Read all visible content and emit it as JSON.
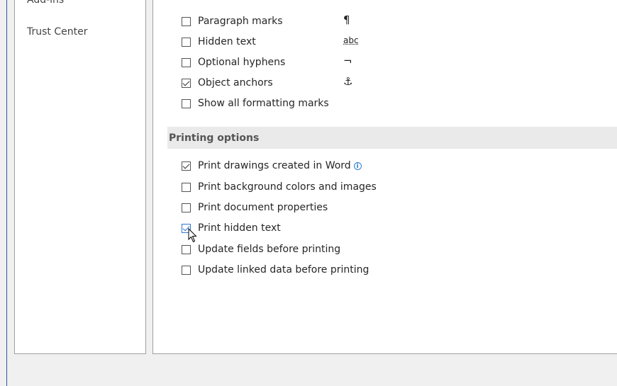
{
  "nav": {
    "partial_item": "Add-ins",
    "trust_center": "Trust Center"
  },
  "display_marks": [
    {
      "label": "Paragraph marks",
      "checked": false,
      "glyph": "¶"
    },
    {
      "label": "Hidden text",
      "checked": false,
      "glyph": "abc"
    },
    {
      "label": "Optional hyphens",
      "checked": false,
      "glyph": "¬"
    },
    {
      "label": "Object anchors",
      "checked": true,
      "glyph": "⚓"
    },
    {
      "label": "Show all formatting marks",
      "checked": false
    }
  ],
  "printing": {
    "header": "Printing options",
    "options": [
      {
        "label": "Print drawings created in Word",
        "checked": true,
        "info": "i"
      },
      {
        "label": "Print background colors and images",
        "checked": false
      },
      {
        "label": "Print document properties",
        "checked": false
      },
      {
        "label": "Print hidden text",
        "checked": true
      },
      {
        "label": "Update fields before printing",
        "checked": false
      },
      {
        "label": "Update linked data before printing",
        "checked": false
      }
    ]
  },
  "colors": {
    "accent": "#2b579a",
    "checkbox_hover": "#3078d6",
    "section_bg": "#eaeaea"
  },
  "icons": {
    "cursor": "mouse-pointer-icon",
    "info": "info-icon"
  }
}
